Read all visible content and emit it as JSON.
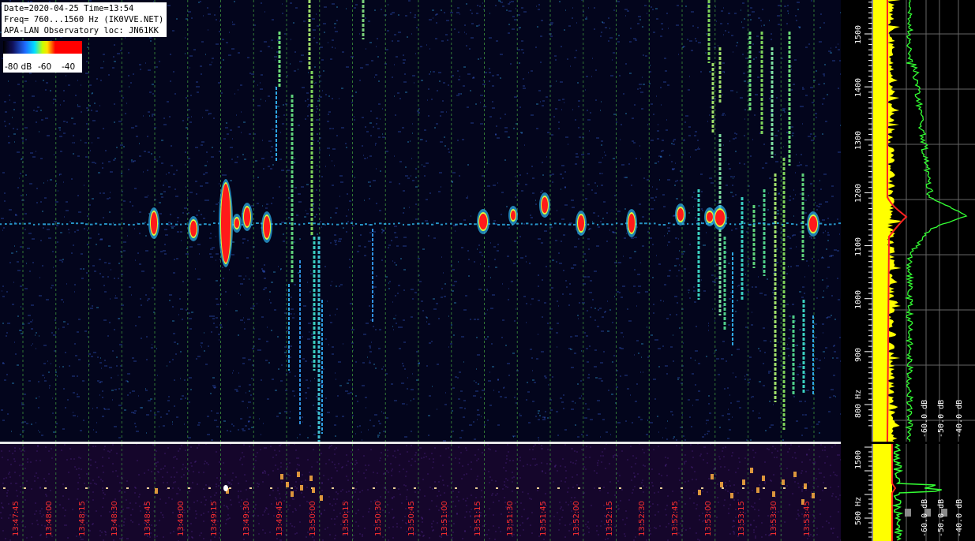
{
  "info": {
    "line1": "Date=2020-04-25 Time=13:54",
    "line2": "Freq= 760...1560 Hz (IK0VVE.NET)",
    "line3": "APA-LAN Observatory loc: JN61KK"
  },
  "colorbar": {
    "label1": "-80 dB",
    "label2": "-60",
    "label3": "-40"
  },
  "freq_axis": {
    "labels": [
      "1500",
      "1400",
      "1300",
      "1200",
      "1100",
      "1000",
      "900",
      "800 Hz"
    ]
  },
  "small_axis": {
    "labels": [
      "1500",
      "500 Hz"
    ]
  },
  "time_axis": {
    "labels": [
      "13:47:45",
      "13:48:00",
      "13:48:15",
      "13:48:30",
      "13:48:45",
      "13:49:00",
      "13:49:15",
      "13:49:30",
      "13:49:45",
      "13:50:00",
      "13:50:15",
      "13:50:30",
      "13:50:45",
      "13:51:00",
      "13:51:15",
      "13:51:30",
      "13:51:45",
      "13:52:00",
      "13:52:15",
      "13:52:30",
      "13:52:45",
      "13:53:00",
      "13:53:15",
      "13:53:30",
      "13:53:45"
    ]
  },
  "spectrum_axis": {
    "labels": [
      "-60.0 dB",
      "-50.0 dB",
      "-40.0 dB"
    ]
  },
  "spectrum_small_axis": {
    "labels": [
      "-60.0 dB",
      "-50.0 dB",
      "-40.0 dB"
    ]
  },
  "colors": {
    "grid": "#3a8a3a",
    "time_label": "#ff3030",
    "spectrum_avg": "#33ff33",
    "spectrum_peak": "#ffff00",
    "spectrum_ref": "#ff2222"
  }
}
